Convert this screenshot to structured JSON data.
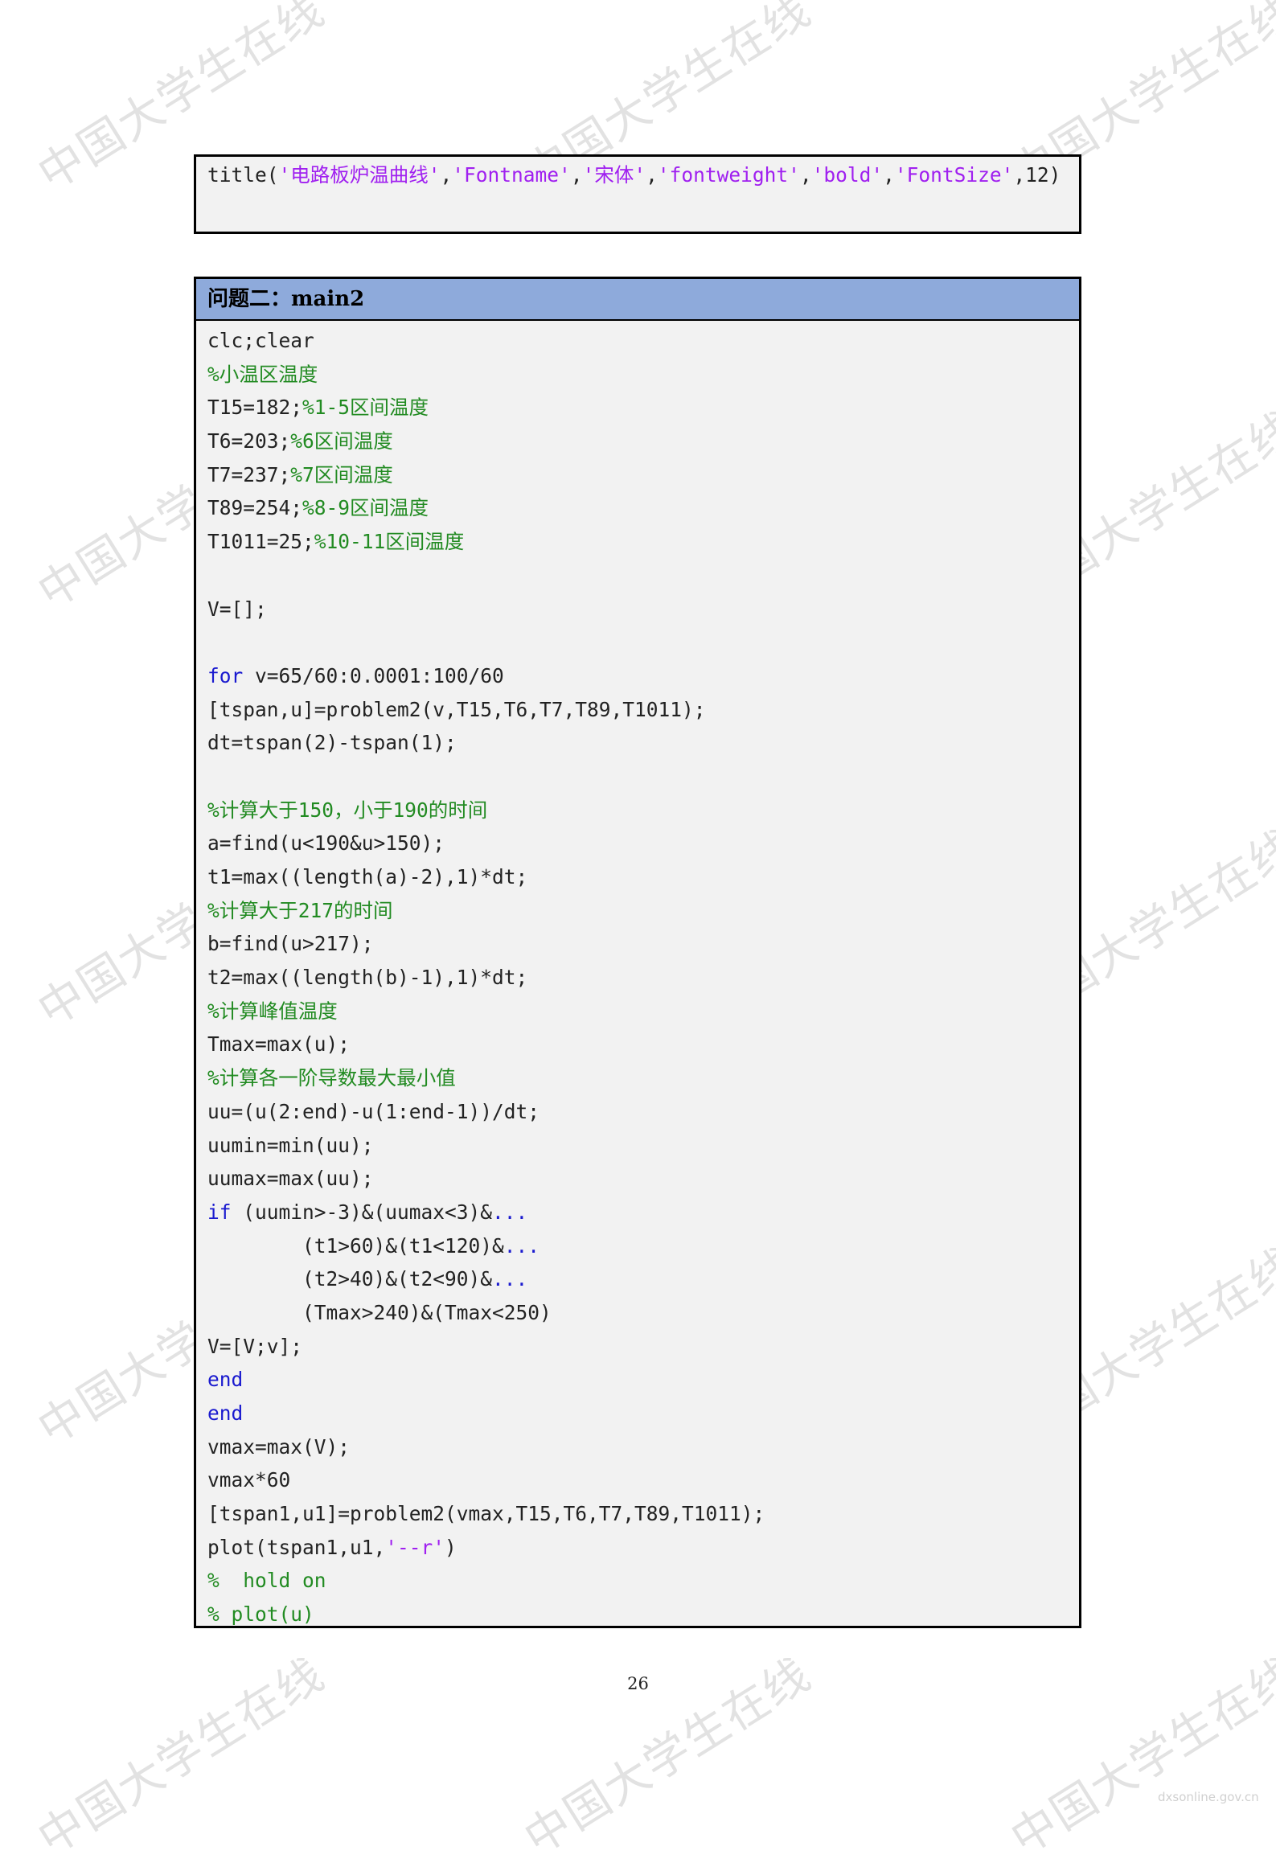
{
  "snippet1": {
    "lines": [
      [
        [
          "title(",
          "n"
        ],
        [
          "'电路板炉温曲线'",
          "s"
        ],
        [
          ",",
          "n"
        ],
        [
          "'Fontname'",
          "s"
        ],
        [
          ",",
          "n"
        ],
        [
          "'宋体'",
          "s"
        ],
        [
          ",",
          "n"
        ],
        [
          "'fontweight'",
          "s"
        ],
        [
          ",",
          "n"
        ],
        [
          "'bold'",
          "s"
        ],
        [
          ",",
          "n"
        ],
        [
          "'FontSize'",
          "s"
        ],
        [
          ",12)",
          "n"
        ]
      ]
    ]
  },
  "snippet2": {
    "header": "问题二：main2",
    "lines": [
      [
        [
          "clc;clear",
          "n"
        ]
      ],
      [
        [
          "%小温区温度",
          "c"
        ]
      ],
      [
        [
          "T15=182;",
          "n"
        ],
        [
          "%1-5区间温度",
          "c"
        ]
      ],
      [
        [
          "T6=203;",
          "n"
        ],
        [
          "%6区间温度",
          "c"
        ]
      ],
      [
        [
          "T7=237;",
          "n"
        ],
        [
          "%7区间温度",
          "c"
        ]
      ],
      [
        [
          "T89=254;",
          "n"
        ],
        [
          "%8-9区间温度",
          "c"
        ]
      ],
      [
        [
          "T1011=25;",
          "n"
        ],
        [
          "%10-11区间温度",
          "c"
        ]
      ],
      [],
      [
        [
          "V=[];",
          "n"
        ]
      ],
      [],
      [
        [
          "for",
          "k"
        ],
        [
          " v=65/60:0.0001:100/60",
          "n"
        ]
      ],
      [
        [
          "[tspan,u]=problem2(v,T15,T6,T7,T89,T1011);",
          "n"
        ]
      ],
      [
        [
          "dt=tspan(2)-tspan(1);",
          "n"
        ]
      ],
      [],
      [
        [
          "%计算大于150，小于190的时间",
          "c"
        ]
      ],
      [
        [
          "a=find(u<190&u>150);",
          "n"
        ]
      ],
      [
        [
          "t1=max((length(a)-2),1)*dt;",
          "n"
        ]
      ],
      [
        [
          "%计算大于217的时间",
          "c"
        ]
      ],
      [
        [
          "b=find(u>217);",
          "n"
        ]
      ],
      [
        [
          "t2=max((length(b)-1),1)*dt;",
          "n"
        ]
      ],
      [
        [
          "%计算峰值温度",
          "c"
        ]
      ],
      [
        [
          "Tmax=max(u);",
          "n"
        ]
      ],
      [
        [
          "%计算各一阶导数最大最小值",
          "c"
        ]
      ],
      [
        [
          "uu=(u(2:end)-u(1:end-1))/dt;",
          "n"
        ]
      ],
      [
        [
          "uumin=min(uu);",
          "n"
        ]
      ],
      [
        [
          "uumax=max(uu);",
          "n"
        ]
      ],
      [
        [
          "if",
          "k"
        ],
        [
          " (uumin>-3)&(uumax<3)&",
          "n"
        ],
        [
          "...",
          "k"
        ]
      ],
      [
        [
          "        (t1>60)&(t1<120)&",
          "n"
        ],
        [
          "...",
          "k"
        ]
      ],
      [
        [
          "        (t2>40)&(t2<90)&",
          "n"
        ],
        [
          "...",
          "k"
        ]
      ],
      [
        [
          "        (Tmax>240)&(Tmax<250)",
          "n"
        ]
      ],
      [
        [
          "V=[V;v];",
          "n"
        ]
      ],
      [
        [
          "end",
          "k"
        ]
      ],
      [
        [
          "end",
          "k"
        ]
      ],
      [
        [
          "vmax=max(V);",
          "n"
        ]
      ],
      [
        [
          "vmax*60",
          "n"
        ]
      ],
      [
        [
          "[tspan1,u1]=problem2(vmax,T15,T6,T7,T89,T1011);",
          "n"
        ]
      ],
      [
        [
          "plot(tspan1,u1,",
          "n"
        ],
        [
          "'--r'",
          "s"
        ],
        [
          ")",
          "n"
        ]
      ],
      [
        [
          "%  hold on",
          "c"
        ]
      ],
      [
        [
          "% plot(u)",
          "c"
        ]
      ]
    ]
  },
  "page_number": "26",
  "watermark_text": "中国大学生在线",
  "corner_note": "dxsonline.gov.cn",
  "colors": {
    "keyword": "#1a1acf",
    "string": "#a020f0",
    "comment": "#228b22",
    "header_bg": "#8eaadb",
    "code_bg": "#f2f2f2"
  }
}
